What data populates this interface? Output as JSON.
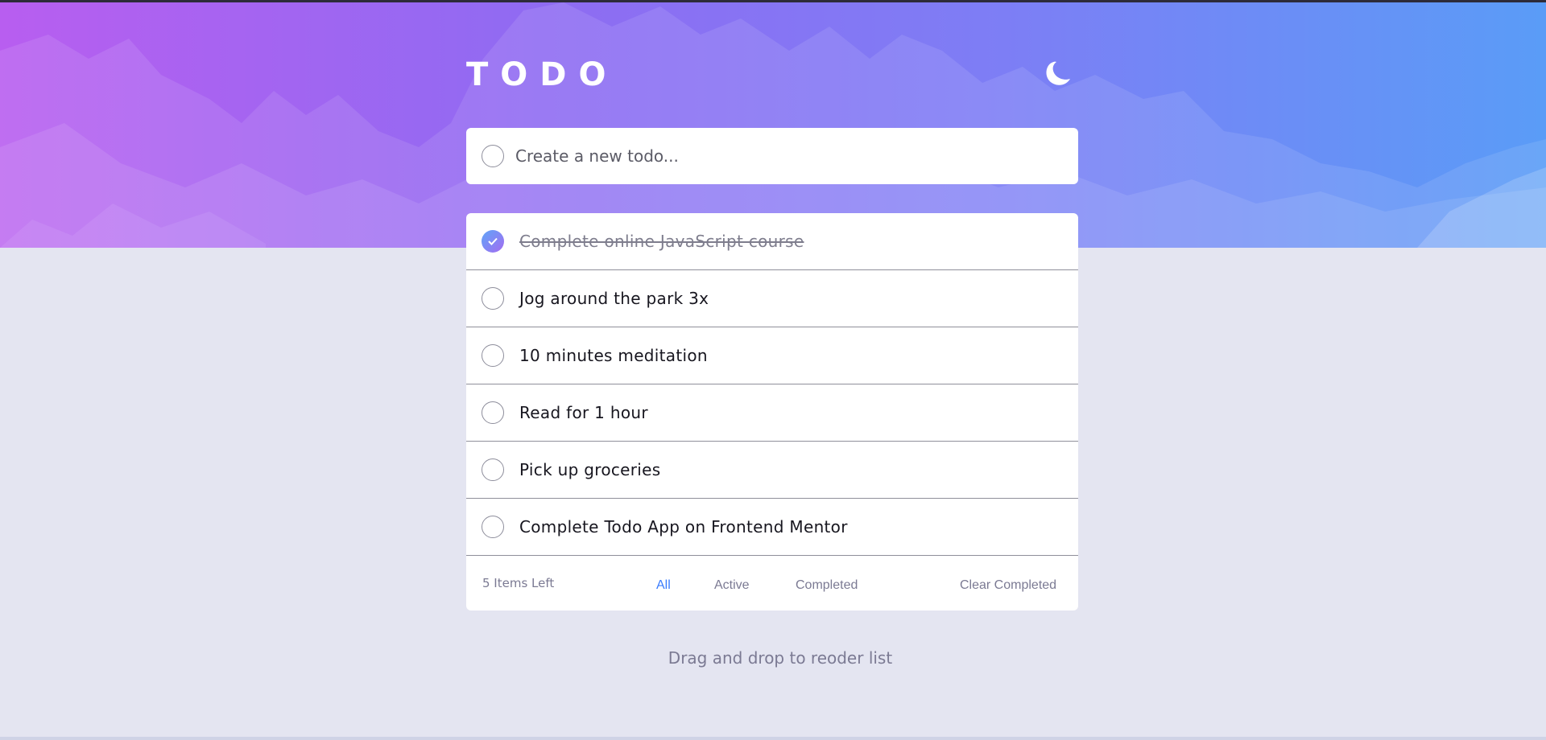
{
  "app": {
    "title": "TODO",
    "theme_icon": "moon-icon",
    "accent": "#3a7cfd"
  },
  "new_todo": {
    "placeholder": "Create a new todo..."
  },
  "todos": [
    {
      "text": "Complete online JavaScript course",
      "completed": true
    },
    {
      "text": "Jog around the park 3x",
      "completed": false
    },
    {
      "text": "10 minutes meditation",
      "completed": false
    },
    {
      "text": "Read for 1 hour",
      "completed": false
    },
    {
      "text": "Pick up groceries",
      "completed": false
    },
    {
      "text": "Complete Todo App on Frontend Mentor",
      "completed": false
    }
  ],
  "footer": {
    "items_left": "5 Items Left",
    "filters": [
      "All",
      "Active",
      "Completed"
    ],
    "active_filter": "All",
    "clear_label": "Clear Completed"
  },
  "hint": "Drag and drop to reoder list"
}
